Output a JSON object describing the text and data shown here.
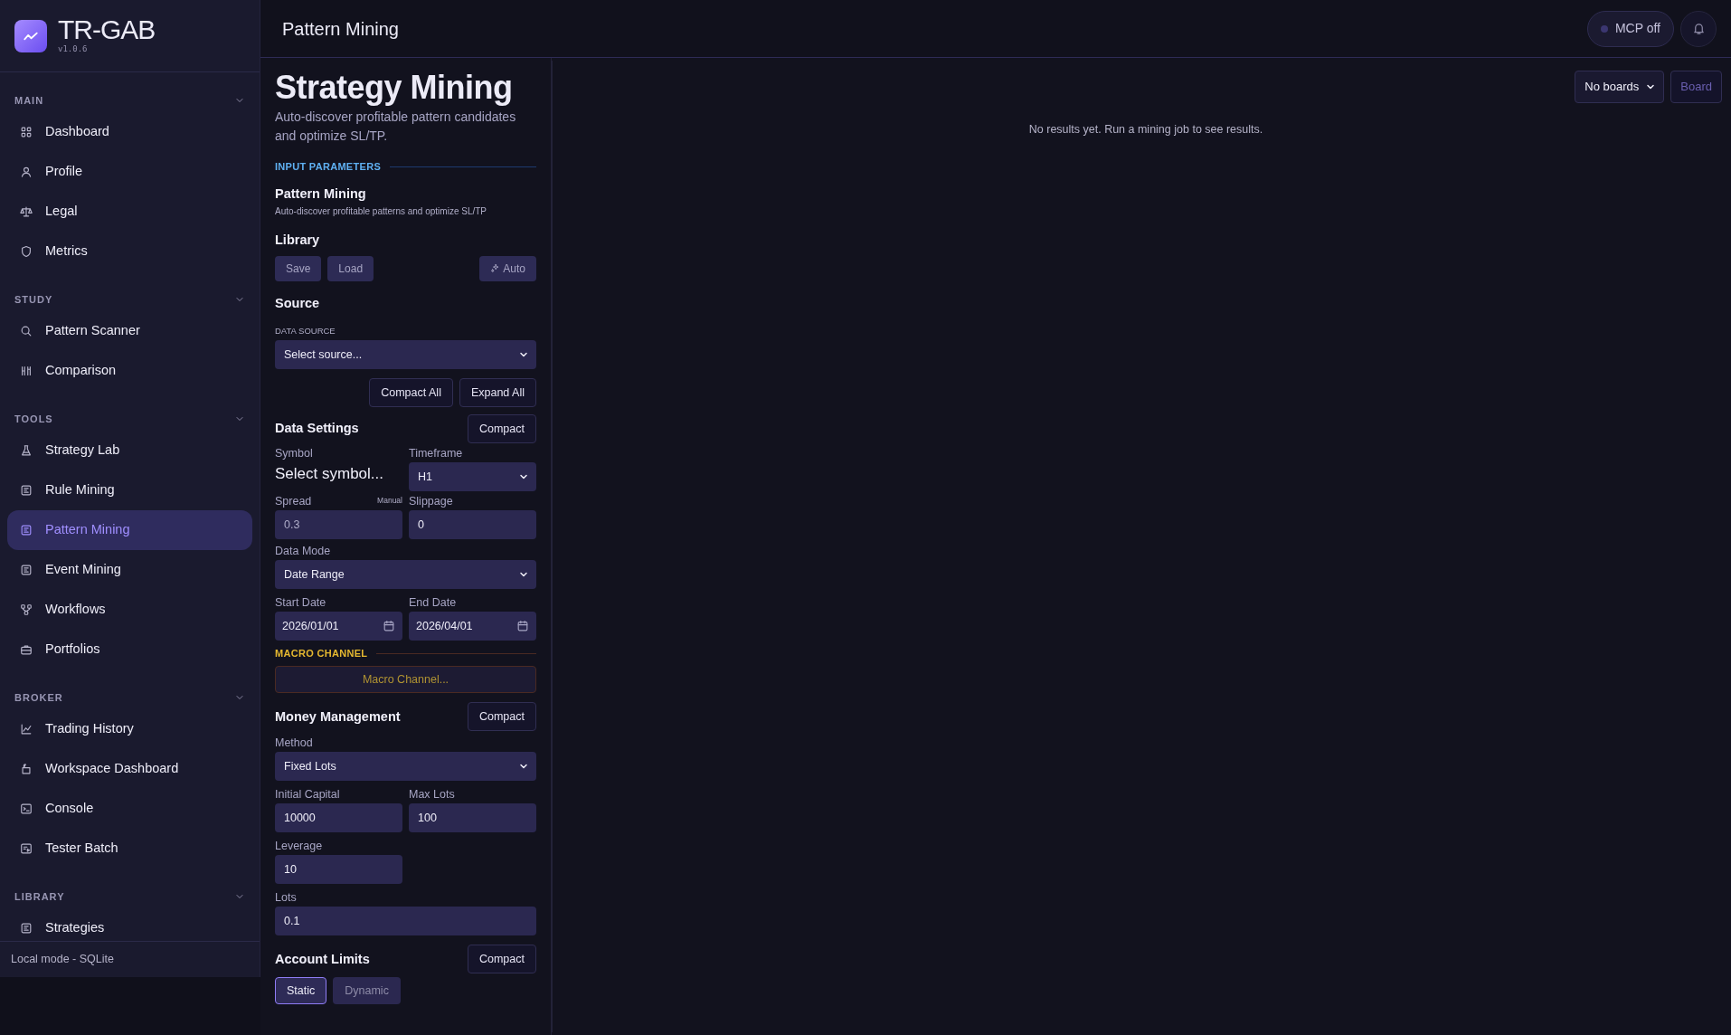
{
  "app": {
    "name": "TR-GAB",
    "version": "v1.0.6"
  },
  "sidebar": {
    "sections": [
      {
        "title": "MAIN",
        "expanded": true,
        "items": [
          {
            "label": "Dashboard",
            "selected": false
          },
          {
            "label": "Profile",
            "selected": false
          },
          {
            "label": "Legal",
            "selected": false
          },
          {
            "label": "Metrics",
            "selected": false
          }
        ]
      },
      {
        "title": "STUDY",
        "expanded": true,
        "items": [
          {
            "label": "Pattern Scanner",
            "selected": false
          },
          {
            "label": "Comparison",
            "selected": false
          }
        ]
      },
      {
        "title": "TOOLS",
        "expanded": true,
        "items": [
          {
            "label": "Strategy Lab",
            "selected": false
          },
          {
            "label": "Rule Mining",
            "selected": false
          },
          {
            "label": "Pattern Mining",
            "selected": true
          },
          {
            "label": "Event Mining",
            "selected": false
          },
          {
            "label": "Workflows",
            "selected": false
          },
          {
            "label": "Portfolios",
            "selected": false
          }
        ]
      },
      {
        "title": "BROKER",
        "expanded": true,
        "items": [
          {
            "label": "Trading History",
            "selected": false
          },
          {
            "label": "Workspace Dashboard",
            "selected": false
          },
          {
            "label": "Console",
            "selected": false
          },
          {
            "label": "Tester Batch",
            "selected": false
          }
        ]
      },
      {
        "title": "LIBRARY",
        "expanded": true,
        "items": [
          {
            "label": "Strategies",
            "selected": false
          }
        ]
      }
    ],
    "footer": "Local mode - SQLite"
  },
  "header": {
    "title": "Pattern Mining",
    "mcp_status": {
      "label": "MCP off",
      "on": false
    }
  },
  "form": {
    "title": "Strategy Mining",
    "subtitle": "Auto-discover profitable pattern candidates and optimize SL/TP.",
    "input_parameters_label": "INPUT PARAMETERS",
    "preset": {
      "title": "Pattern Mining",
      "description": "Auto-discover profitable patterns and optimize SL/TP"
    },
    "library": {
      "title": "Library",
      "buttons": [
        "Save",
        "Load"
      ],
      "auto_button": "Auto"
    },
    "source": {
      "title": "Source",
      "label": "DATA SOURCE",
      "value": "Select source...",
      "buttons": [
        "Compact All",
        "Expand All"
      ]
    },
    "data_settings": {
      "title": "Data Settings",
      "compact_button": "Compact",
      "symbol": {
        "label": "Symbol",
        "value": "Select symbol..."
      },
      "timeframe": {
        "label": "Timeframe",
        "value": "H1"
      },
      "spread": {
        "label": "Spread",
        "badge": "Manual",
        "value": "0.3",
        "disabled": true
      },
      "slippage": {
        "label": "Slippage",
        "value": "0",
        "disabled": false
      },
      "data_mode": {
        "label": "Data Mode",
        "value": "Date Range"
      },
      "start_date": {
        "label": "Start Date",
        "value": "2026/01/01"
      },
      "end_date": {
        "label": "End Date",
        "value": "2026/04/01"
      }
    },
    "macro_channel": {
      "label": "MACRO CHANNEL",
      "button": "Macro Channel..."
    },
    "money_management": {
      "title": "Money Management",
      "compact_button": "Compact",
      "method": {
        "label": "Method",
        "value": "Fixed Lots"
      },
      "initial_capital": {
        "label": "Initial Capital",
        "value": "10000"
      },
      "max_lots": {
        "label": "Max Lots",
        "value": "100"
      },
      "leverage": {
        "label": "Leverage",
        "value": "10"
      },
      "lots": {
        "label": "Lots",
        "value": "0.1"
      }
    },
    "account_limits": {
      "title": "Account Limits",
      "compact_button": "Compact",
      "modes": [
        {
          "label": "Static",
          "selected": true
        },
        {
          "label": "Dynamic",
          "selected": false
        }
      ]
    }
  },
  "results": {
    "boards": {
      "value": "No boards"
    },
    "board_button": {
      "label": "Board",
      "disabled": true
    },
    "empty_message": "No results yet. Run a mining job to see results."
  }
}
